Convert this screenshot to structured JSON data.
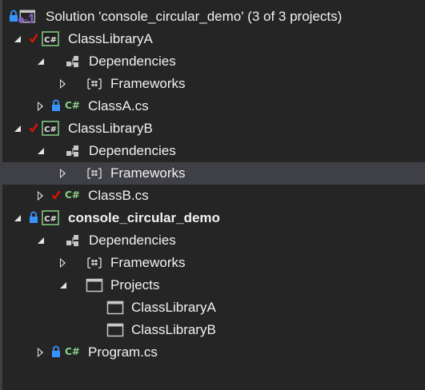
{
  "solution": {
    "label": "Solution 'console_circular_demo' (3 of 3 projects)"
  },
  "icons": {
    "lock": "lock-icon",
    "check": "pending-edit-checkmark-icon",
    "solution": "visual-studio-solution-icon",
    "csproj": "csharp-project-icon",
    "csfile": "csharp-file-icon",
    "dependencies": "dependencies-icon",
    "frameworks": "frameworks-icon",
    "projects_folder": "projects-folder-icon",
    "project_ref": "project-reference-icon"
  },
  "colors": {
    "background": "#252526",
    "selection": "#3f3f46",
    "text": "#f1f1f1",
    "lock": "#3794ff",
    "check": "#e51400",
    "csharp": "#89d185",
    "vs_purple": "#865fc5"
  },
  "selected_row": "Frameworks",
  "projects": [
    {
      "name": "ClassLibraryA",
      "dependencies": "Dependencies",
      "frameworks": "Frameworks",
      "file": "ClassA.cs",
      "file_cs_glyph": "C#"
    },
    {
      "name": "ClassLibraryB",
      "dependencies": "Dependencies",
      "frameworks": "Frameworks",
      "file": "ClassB.cs",
      "file_cs_glyph": "C#"
    },
    {
      "name": "console_circular_demo",
      "dependencies": "Dependencies",
      "frameworks": "Frameworks",
      "projects_folder": "Projects",
      "project_refs": [
        "ClassLibraryA",
        "ClassLibraryB"
      ],
      "file": "Program.cs",
      "file_cs_glyph": "C#"
    }
  ],
  "csproj_glyph": "C#"
}
